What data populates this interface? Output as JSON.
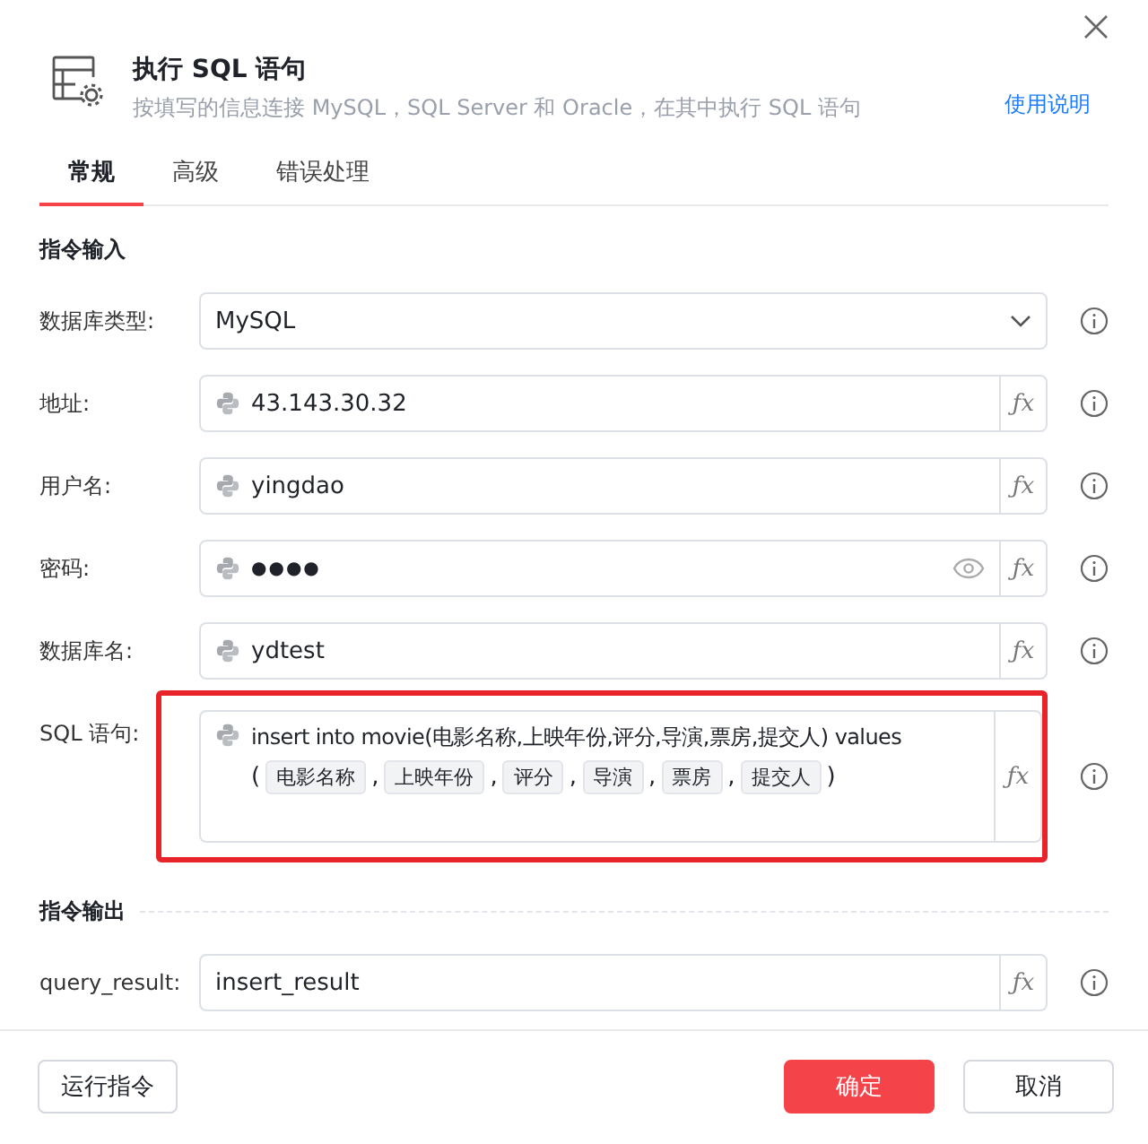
{
  "header": {
    "title": "执行 SQL 语句",
    "subtitle": "按填写的信息连接 MySQL，SQL Server 和 Oracle，在其中执行 SQL 语句",
    "help_link": "使用说明"
  },
  "tabs": [
    {
      "label": "常规",
      "selected": true
    },
    {
      "label": "高级",
      "selected": false
    },
    {
      "label": "错误处理",
      "selected": false
    }
  ],
  "input_section": {
    "title": "指令输入",
    "fields": [
      {
        "kind": "select",
        "label": "数据库类型:",
        "value": "MySQL"
      },
      {
        "kind": "text",
        "label": "地址:",
        "value": "43.143.30.32",
        "formula_button": "ƒx"
      },
      {
        "kind": "text",
        "label": "用户名:",
        "value": "yingdao",
        "formula_button": "ƒx"
      },
      {
        "kind": "password",
        "label": "密码:",
        "value": "●●●●",
        "formula_button": "ƒx"
      },
      {
        "kind": "text",
        "label": "数据库名:",
        "value": "ydtest",
        "formula_button": "ƒx"
      },
      {
        "kind": "sql",
        "label": "SQL 语句:",
        "highlighted": true,
        "value": "insert into movie(电影名称,上映年份,评分,导演,票房,提交人) values",
        "parts": [
          {
            "kind": "plain",
            "text": "("
          },
          {
            "kind": "tag",
            "text": "电影名称"
          },
          {
            "kind": "plain",
            "text": ","
          },
          {
            "kind": "tag",
            "text": "上映年份"
          },
          {
            "kind": "plain",
            "text": ","
          },
          {
            "kind": "tag",
            "text": "评分"
          },
          {
            "kind": "plain",
            "text": ","
          },
          {
            "kind": "tag",
            "text": "导演"
          },
          {
            "kind": "plain",
            "text": ","
          },
          {
            "kind": "tag",
            "text": "票房"
          },
          {
            "kind": "plain",
            "text": ","
          },
          {
            "kind": "tag",
            "text": "提交人"
          },
          {
            "kind": "plain",
            "text": ")"
          }
        ],
        "formula_button": "ƒx"
      }
    ]
  },
  "output_section": {
    "title": "指令输出",
    "fields": [
      {
        "label": "query_result:",
        "value": "insert_result",
        "formula_button": "ƒx"
      }
    ]
  },
  "footer": {
    "run_button": "运行指令",
    "buttons": [
      {
        "label": "确定",
        "primary": true
      },
      {
        "label": "取消",
        "primary": false
      }
    ]
  }
}
